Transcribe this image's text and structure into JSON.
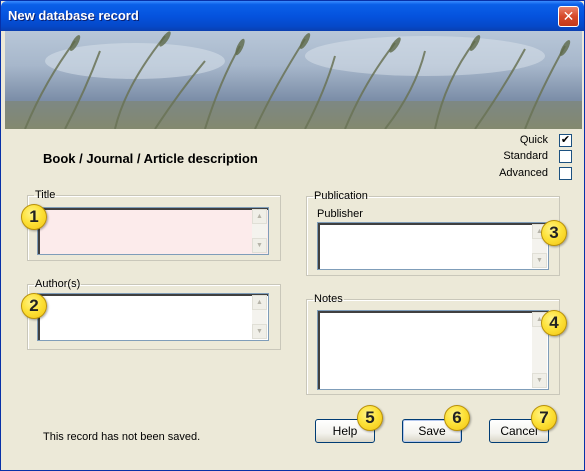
{
  "window": {
    "title": "New database record",
    "close_glyph": "✕"
  },
  "heading": "Book / Journal / Article description",
  "modes": [
    {
      "label": "Quick",
      "checked": true
    },
    {
      "label": "Standard",
      "checked": false
    },
    {
      "label": "Advanced",
      "checked": false
    }
  ],
  "groups": {
    "title": {
      "legend": "Title",
      "value": ""
    },
    "authors": {
      "legend": "Author(s)",
      "value": ""
    },
    "publication": {
      "legend": "Publication",
      "publisher_label": "Publisher",
      "value": ""
    },
    "notes": {
      "legend": "Notes",
      "value": ""
    }
  },
  "status": "This record has not been saved.",
  "buttons": {
    "help": "Help",
    "save": "Save",
    "cancel": "Cancel"
  },
  "badges": [
    "1",
    "2",
    "3",
    "4",
    "5",
    "6",
    "7"
  ],
  "scroll_glyphs": {
    "up": "▲",
    "down": "▼"
  },
  "check_glyph": "✔",
  "colors": {
    "titlebar": "#0553DE",
    "dialog_bg": "#ECE9D8",
    "title_field_bg": "#FCEBEB",
    "badge": "#FDE23A"
  }
}
